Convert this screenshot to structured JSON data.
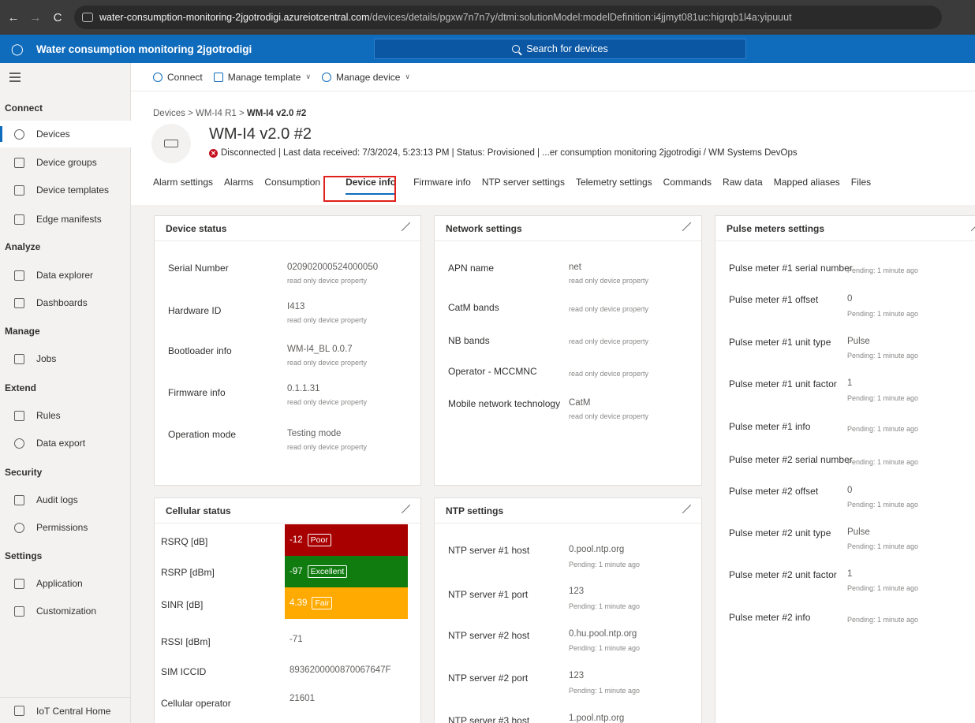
{
  "browser": {
    "url_host": "water-consumption-monitoring-2jgotrodigi.azureiotcentral.com",
    "url_path": "/devices/details/pgxw7n7n7y/dtmi:solutionModel:modelDefinition:i4jjmyt081uc:higrqb1l4a:yipuuut"
  },
  "app": {
    "title": "Water consumption monitoring 2jgotrodigi",
    "search_placeholder": "Search for devices"
  },
  "sidebar": {
    "sections": {
      "connect": "Connect",
      "analyze": "Analyze",
      "manage": "Manage",
      "extend": "Extend",
      "security": "Security",
      "settings": "Settings"
    },
    "items": {
      "devices": "Devices",
      "device_groups": "Device groups",
      "device_templates": "Device templates",
      "edge_manifests": "Edge manifests",
      "data_explorer": "Data explorer",
      "dashboards": "Dashboards",
      "jobs": "Jobs",
      "rules": "Rules",
      "data_export": "Data export",
      "audit_logs": "Audit logs",
      "permissions": "Permissions",
      "application": "Application",
      "customization": "Customization"
    },
    "home": "IoT Central Home"
  },
  "commands": {
    "connect": "Connect",
    "manage_template": "Manage template",
    "manage_device": "Manage device"
  },
  "device": {
    "breadcrumb_root": "Devices",
    "breadcrumb_parent": "WM-I4 R1",
    "breadcrumb_current": "WM-I4 v2.0 #2",
    "title": "WM-I4 v2.0 #2",
    "status_line": "Disconnected  |  Last data received: 7/3/2024, 5:23:13 PM  |  Status: Provisioned  |  ...er consumption monitoring 2jgotrodigi / WM Systems DevOps"
  },
  "tabs": {
    "alarm_settings": "Alarm settings",
    "alarms": "Alarms",
    "consumption": "Consumption",
    "device_info": "Device info",
    "firmware_info": "Firmware info",
    "ntp_server_settings": "NTP server settings",
    "telemetry_settings": "Telemetry settings",
    "commands": "Commands",
    "raw_data": "Raw data",
    "mapped_aliases": "Mapped aliases",
    "files": "Files"
  },
  "labels": {
    "readonly": "read only device property",
    "pending": "Pending: 1 minute ago"
  },
  "device_status": {
    "title": "Device status",
    "serial_label": "Serial Number",
    "serial_value": "020902000524000050",
    "hardware_label": "Hardware ID",
    "hardware_value": "I413",
    "bootloader_label": "Bootloader info",
    "bootloader_value": "WM-I4_BL 0.0.7",
    "firmware_label": "Firmware info",
    "firmware_value": "0.1.1.31",
    "opmode_label": "Operation mode",
    "opmode_value": "Testing mode"
  },
  "network": {
    "title": "Network settings",
    "apn_label": "APN name",
    "apn_value": "net",
    "catm_label": "CatM bands",
    "nb_label": "NB bands",
    "operator_label": "Operator - MCCMNC",
    "mobile_label": "Mobile network technology",
    "mobile_value": "CatM"
  },
  "pulse": {
    "title": "Pulse meters settings",
    "p1_serial": "Pulse meter #1 serial number",
    "p1_offset": "Pulse meter #1 offset",
    "p1_offset_value": "0",
    "p1_unit_type": "Pulse meter #1 unit type",
    "p1_unit_type_value": "Pulse",
    "p1_unit_factor": "Pulse meter #1 unit factor",
    "p1_unit_factor_value": "1",
    "p1_info": "Pulse meter #1 info",
    "p2_serial": "Pulse meter #2 serial number",
    "p2_offset": "Pulse meter #2 offset",
    "p2_offset_value": "0",
    "p2_unit_type": "Pulse meter #2 unit type",
    "p2_unit_type_value": "Pulse",
    "p2_unit_factor": "Pulse meter #2 unit factor",
    "p2_unit_factor_value": "1",
    "p2_info": "Pulse meter #2 info"
  },
  "cellular": {
    "title": "Cellular status",
    "rsrq_label": "RSRQ [dB]",
    "rsrq_value": "-12",
    "rsrq_badge": "Poor",
    "rsrp_label": "RSRP [dBm]",
    "rsrp_value": "-97",
    "rsrp_badge": "Excellent",
    "sinr_label": "SINR [dB]",
    "sinr_value": "4.39",
    "sinr_badge": "Fair",
    "rssi_label": "RSSI [dBm]",
    "rssi_value": "-71",
    "iccid_label": "SIM ICCID",
    "iccid_value": "8936200000870067647F",
    "operator_label": "Cellular operator",
    "operator_value": "21601",
    "colors": {
      "poor": "#a80000",
      "excellent": "#107c10",
      "fair": "#ffaa00"
    }
  },
  "ntp": {
    "title": "NTP settings",
    "h1_label": "NTP server #1 host",
    "h1_value": "0.pool.ntp.org",
    "p1_label": "NTP server #1 port",
    "p1_value": "123",
    "h2_label": "NTP server #2 host",
    "h2_value": "0.hu.pool.ntp.org",
    "p2_label": "NTP server #2 port",
    "p2_value": "123",
    "h3_label": "NTP server #3 host",
    "h3_value": "1.pool.ntp.org"
  }
}
